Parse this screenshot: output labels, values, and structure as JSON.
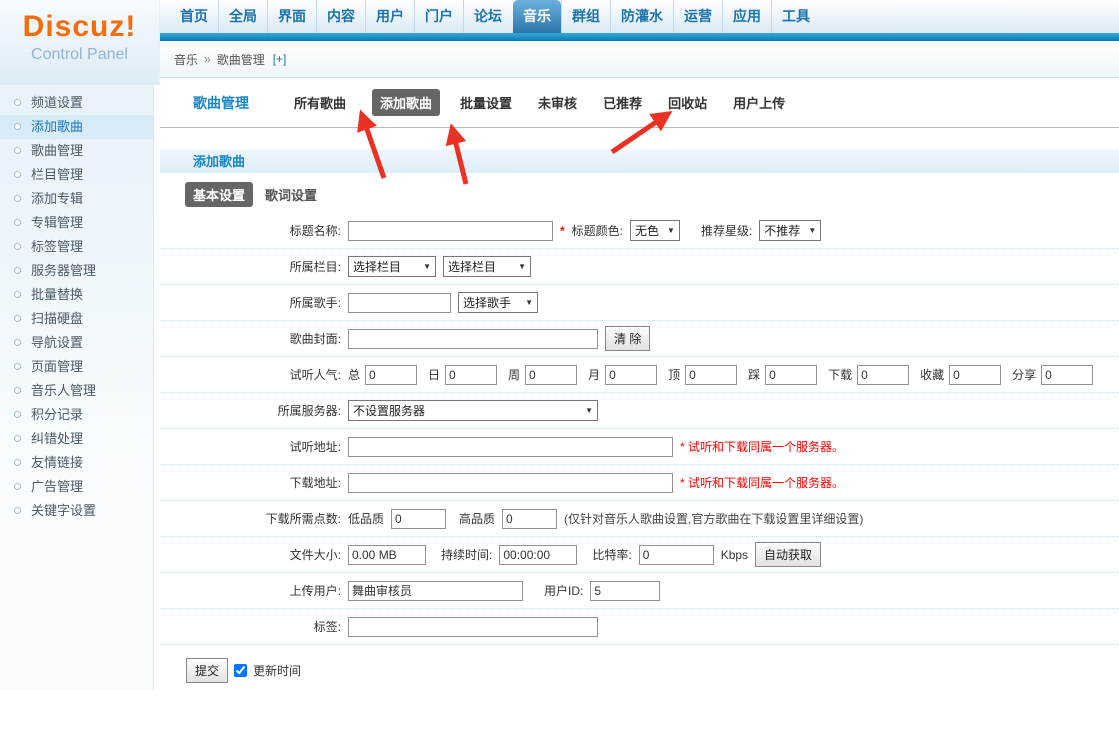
{
  "logo": {
    "title": "Discuz!",
    "subtitle": "Control Panel"
  },
  "topnav": {
    "items": [
      {
        "label": "首页"
      },
      {
        "label": "全局"
      },
      {
        "label": "界面"
      },
      {
        "label": "内容"
      },
      {
        "label": "用户"
      },
      {
        "label": "门户"
      },
      {
        "label": "论坛"
      },
      {
        "label": "音乐"
      },
      {
        "label": "群组"
      },
      {
        "label": "防灌水"
      },
      {
        "label": "运营"
      },
      {
        "label": "应用"
      },
      {
        "label": "工具"
      }
    ]
  },
  "breadcrumb": {
    "section": "音乐",
    "sep": "»",
    "page": "歌曲管理",
    "expand": "[+]"
  },
  "sidebar": {
    "items": [
      {
        "label": "频道设置"
      },
      {
        "label": "添加歌曲"
      },
      {
        "label": "歌曲管理"
      },
      {
        "label": "栏目管理"
      },
      {
        "label": "添加专辑"
      },
      {
        "label": "专辑管理"
      },
      {
        "label": "标签管理"
      },
      {
        "label": "服务器管理"
      },
      {
        "label": "批量替换"
      },
      {
        "label": "扫描硬盘"
      },
      {
        "label": "导航设置"
      },
      {
        "label": "页面管理"
      },
      {
        "label": "音乐人管理"
      },
      {
        "label": "积分记录"
      },
      {
        "label": "纠错处理"
      },
      {
        "label": "友情链接"
      },
      {
        "label": "广告管理"
      },
      {
        "label": "关键字设置"
      }
    ]
  },
  "content": {
    "page_title": "歌曲管理",
    "tabs": [
      {
        "label": "所有歌曲"
      },
      {
        "label": "添加歌曲"
      },
      {
        "label": "批量设置"
      },
      {
        "label": "未审核"
      },
      {
        "label": "已推荐"
      },
      {
        "label": "回收站"
      },
      {
        "label": "用户上传"
      }
    ],
    "section_title": "添加歌曲",
    "subtabs": [
      {
        "label": "基本设置"
      },
      {
        "label": "歌词设置"
      }
    ],
    "form": {
      "title": {
        "label": "标题名称:",
        "value": "",
        "required": "*",
        "color_label": "标题颜色:",
        "color_value": "无色",
        "star_label": "推荐星级:",
        "star_value": "不推荐"
      },
      "column": {
        "label": "所属栏目:",
        "select1": "选择栏目",
        "select2": "选择栏目"
      },
      "singer": {
        "label": "所属歌手:",
        "value": "",
        "select": "选择歌手"
      },
      "cover": {
        "label": "歌曲封面:",
        "value": "",
        "clear_button": "清 除"
      },
      "stats": {
        "label": "试听人气:",
        "items": [
          {
            "label": "总",
            "value": "0"
          },
          {
            "label": "日",
            "value": "0"
          },
          {
            "label": "周",
            "value": "0"
          },
          {
            "label": "月",
            "value": "0"
          },
          {
            "label": "顶",
            "value": "0"
          },
          {
            "label": "踩",
            "value": "0"
          },
          {
            "label": "下载",
            "value": "0"
          },
          {
            "label": "收藏",
            "value": "0"
          },
          {
            "label": "分享",
            "value": "0"
          }
        ]
      },
      "server": {
        "label": "所属服务器:",
        "value": "不设置服务器"
      },
      "listen": {
        "label": "试听地址:",
        "value": "",
        "note": "* 试听和下载同属一个服务器。"
      },
      "download": {
        "label": "下载地址:",
        "value": "",
        "note": "* 试听和下载同属一个服务器。"
      },
      "points": {
        "label": "下载所需点数:",
        "low_label": "低品质",
        "low_value": "0",
        "high_label": "高品质",
        "high_value": "0",
        "note": "(仅针对音乐人歌曲设置,官方歌曲在下载设置里详细设置)"
      },
      "file": {
        "label": "文件大小:",
        "size_value": "0.00 MB",
        "duration_label": "持续时间:",
        "duration_value": "00:00:00",
        "bitrate_label": "比特率:",
        "bitrate_value": "0",
        "unit": "Kbps",
        "auto_button": "自动获取"
      },
      "uploader": {
        "label": "上传用户:",
        "value": "舞曲审核员",
        "uid_label": "用户ID:",
        "uid_value": "5"
      },
      "tags": {
        "label": "标签:",
        "value": ""
      },
      "submit": {
        "button": "提交",
        "checkbox_label": "更新时间",
        "checked": "checked"
      }
    }
  },
  "colors": {
    "logo_orange": "#f66c0a",
    "nav_blue": "#1d74ac",
    "active_tab_blue": "#1a679f",
    "teal_bar": "#0d7ab1",
    "title_blue": "#1787c8",
    "pill_gray": "#666666",
    "arrow_red": "#e93223",
    "required_red": "#ff0000",
    "sidebar_active_bg": "#d8ecf8"
  }
}
